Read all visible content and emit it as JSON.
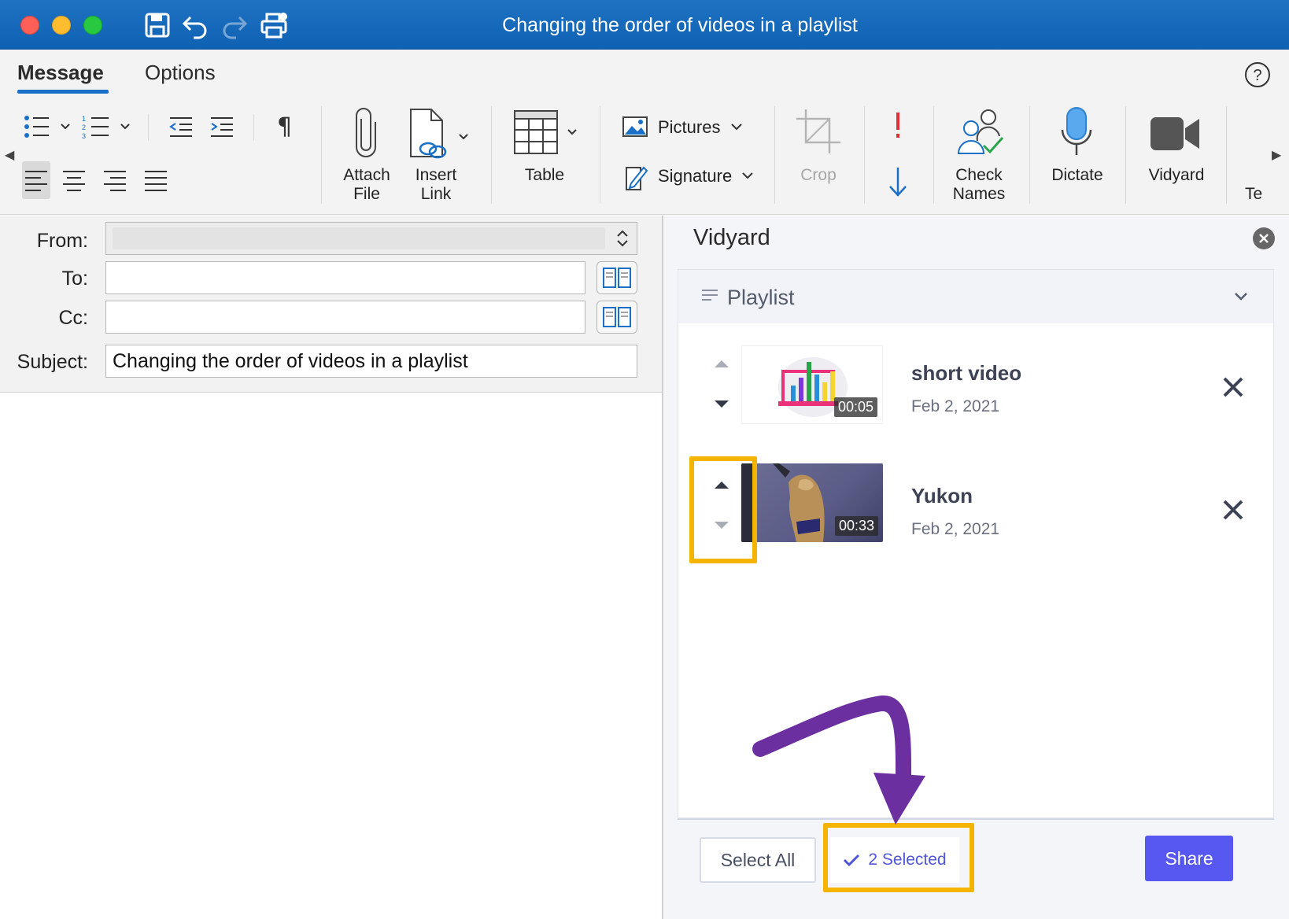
{
  "window": {
    "title": "Changing the order of videos in a playlist"
  },
  "tabs": [
    {
      "label": "Message",
      "active": true
    },
    {
      "label": "Options",
      "active": false
    }
  ],
  "ribbon": {
    "attach_file": "Attach\nFile",
    "insert_link": "Insert\nLink",
    "table": "Table",
    "pictures": "Pictures",
    "signature": "Signature",
    "crop": "Crop",
    "check_names": "Check\nNames",
    "dictate": "Dictate",
    "vidyard": "Vidyard",
    "overflow": "Te"
  },
  "compose": {
    "from_label": "From:",
    "to_label": "To:",
    "cc_label": "Cc:",
    "subject_label": "Subject:",
    "to_value": "",
    "cc_value": "",
    "subject_value": "Changing the order of videos in a playlist"
  },
  "vidyard": {
    "panel_title": "Vidyard",
    "playlist_label": "Playlist",
    "videos": [
      {
        "title": "short video",
        "date": "Feb 2, 2021",
        "duration": "00:05"
      },
      {
        "title": "Yukon",
        "date": "Feb 2, 2021",
        "duration": "00:33"
      }
    ],
    "select_all": "Select All",
    "selected": "2 Selected",
    "share": "Share"
  },
  "colors": {
    "titlebar": "#1a6bbd",
    "accent": "#5757f2",
    "highlight": "#f5b400",
    "annotation_arrow": "#6b2fa0"
  }
}
